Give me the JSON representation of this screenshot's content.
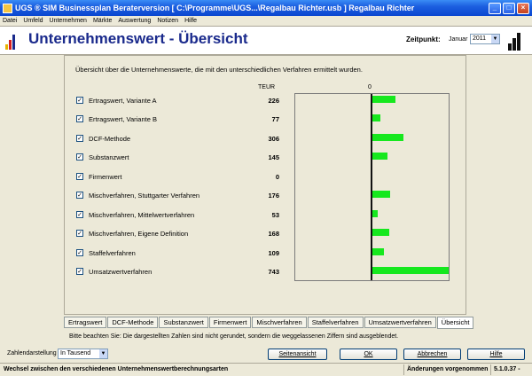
{
  "window": {
    "title": "UGS ® SIM Businessplan Beraterversion   [ C:\\Programme\\UGS...\\Regalbau Richter.usb ] Regalbau Richter",
    "minimize": "_",
    "maximize": "□",
    "close": "×"
  },
  "menu": [
    "Datei",
    "Umfeld",
    "Unternehmen",
    "Märkte",
    "Auswertung",
    "Notizen",
    "Hilfe"
  ],
  "header": {
    "title": "Unternehmenswert - Übersicht",
    "zeitpunkt_label": "Zeitpunkt:",
    "month": "Januar",
    "year": "2011"
  },
  "panel": {
    "intro": "Übersicht über die Unternehmenswerte, die mit den unterschiedlichen Verfahren ermittelt wurden.",
    "col_unit": "TEUR",
    "col_zero": "0"
  },
  "rows": [
    {
      "label": "Ertragswert, Variante A",
      "value": "226",
      "checked": "✓"
    },
    {
      "label": "Ertragswert, Variante B",
      "value": "77",
      "checked": "✓"
    },
    {
      "label": "DCF-Methode",
      "value": "306",
      "checked": "✓"
    },
    {
      "label": "Substanzwert",
      "value": "145",
      "checked": "✓"
    },
    {
      "label": "Firmenwert",
      "value": "0",
      "checked": "✓"
    },
    {
      "label": "Mischverfahren, Stuttgarter Verfahren",
      "value": "176",
      "checked": "✓"
    },
    {
      "label": "Mischverfahren, Mittelwertverfahren",
      "value": "53",
      "checked": "✓"
    },
    {
      "label": "Mischverfahren, Eigene Definition",
      "value": "168",
      "checked": "✓"
    },
    {
      "label": "Staffelverfahren",
      "value": "109",
      "checked": "✓"
    },
    {
      "label": "Umsatzwertverfahren",
      "value": "743",
      "checked": "✓"
    }
  ],
  "chart_data": {
    "type": "bar",
    "categories": [
      "Ertragswert, Variante A",
      "Ertragswert, Variante B",
      "DCF-Methode",
      "Substanzwert",
      "Firmenwert",
      "Mischverfahren, Stuttgarter Verfahren",
      "Mischverfahren, Mittelwertverfahren",
      "Mischverfahren, Eigene Definition",
      "Staffelverfahren",
      "Umsatzwertverfahren"
    ],
    "values": [
      226,
      77,
      306,
      145,
      0,
      176,
      53,
      168,
      109,
      743
    ],
    "bar_color": "#16e81e"
  },
  "tabs": [
    "Ertragswert",
    "DCF-Methode",
    "Substanzwert",
    "Firmenwert",
    "Mischverfahren",
    "Staffelverfahren",
    "Umsatzwertverfahren",
    "Übersicht"
  ],
  "active_tab": "Übersicht",
  "note": "Bitte beachten Sie: Die dargestellten Zahlen sind nicht gerundet, sondern  die weggelassenen Ziffern sind ausgeblendet.",
  "bottom": {
    "zahlendarstellung_label": "Zahlendarstellung",
    "zahlendarstellung_value": "In Tausend",
    "seitenansicht": "Seitenansicht",
    "ok": "OK",
    "abbrechen": "Abbrechen",
    "hilfe": "Hilfe"
  },
  "status": {
    "main": "Wechsel zwischen den verschiedenen Unternehmenswertberechnungsarten",
    "changes": "Änderungen vorgenommen",
    "version": "5.1.0.37 -"
  },
  "colors": {
    "title_blue": "#1a2a8c",
    "titlebar": "#0a46d0",
    "bar_green": "#16e81e"
  }
}
